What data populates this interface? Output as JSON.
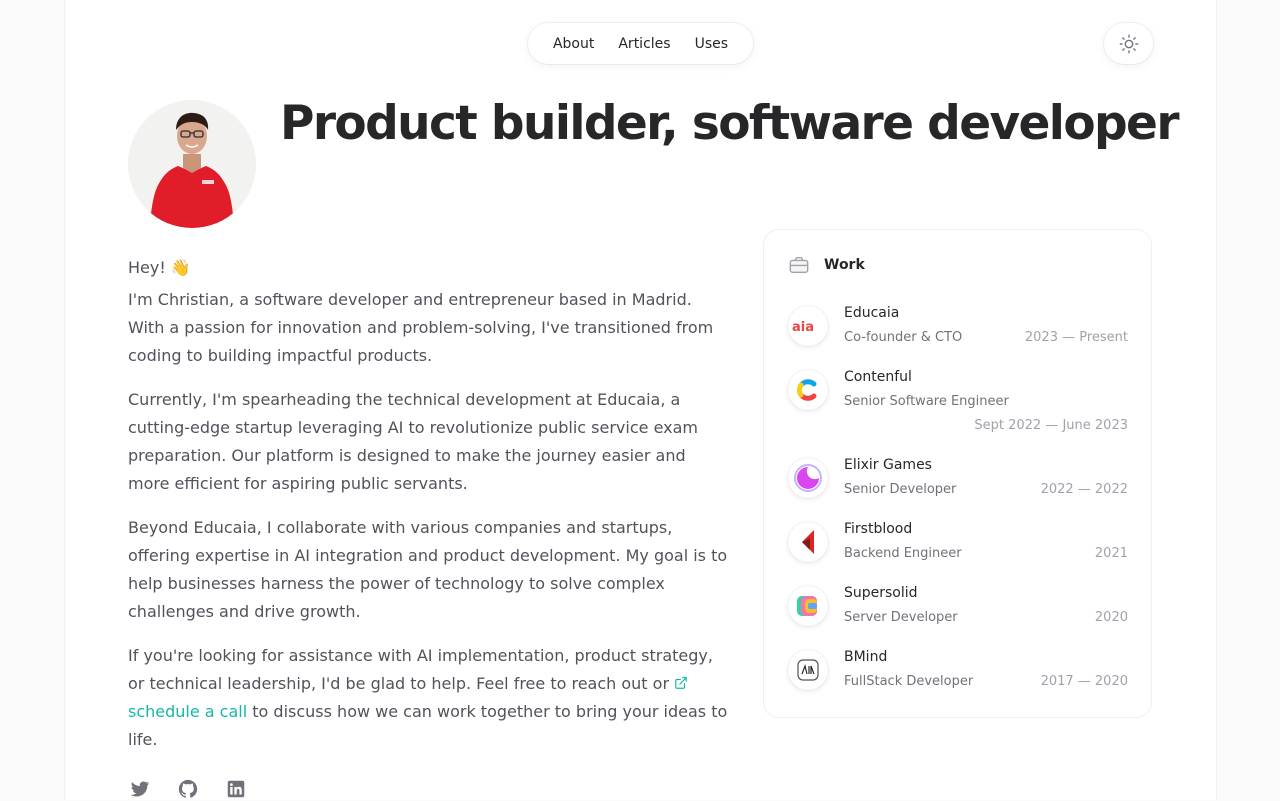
{
  "nav": {
    "items": [
      "About",
      "Articles",
      "Uses"
    ]
  },
  "header": {
    "title": "Product builder, software developer"
  },
  "bio": {
    "greeting": "Hey! 👋",
    "p1": "I'm Christian, a software developer and entrepreneur based in Madrid. With a passion for innovation and problem-solving, I've transitioned from coding to building impactful products.",
    "p2": "Currently, I'm spearheading the technical development at Educaia, a cutting-edge startup leveraging AI to revolutionize public service exam preparation. Our platform is designed to make the journey easier and more efficient for aspiring public servants.",
    "p3": "Beyond Educaia, I collaborate with various companies and startups, offering expertise in AI integration and product development. My goal is to help businesses harness the power of technology to solve complex challenges and drive growth.",
    "p4_before": "If you're looking for assistance with AI implementation, product strategy, or technical leadership, I'd be glad to help. Feel free to reach out or",
    "p4_link": "schedule a call",
    "p4_after": "to discuss how we can work together to bring your ideas to life."
  },
  "socials": [
    "twitter-icon",
    "github-icon",
    "linkedin-icon"
  ],
  "work": {
    "title": "Work",
    "jobs": [
      {
        "company": "Educaia",
        "role": "Co-founder & CTO",
        "dates": "2023 — Present"
      },
      {
        "company": "Contenful",
        "role": "Senior Software Engineer",
        "dates": "Sept 2022 — June 2023"
      },
      {
        "company": "Elixir Games",
        "role": "Senior Developer",
        "dates": "2022 — 2022"
      },
      {
        "company": "Firstblood",
        "role": "Backend Engineer",
        "dates": "2021"
      },
      {
        "company": "Supersolid",
        "role": "Server Developer",
        "dates": "2020"
      },
      {
        "company": "BMind",
        "role": "FullStack Developer",
        "dates": "2017 — 2020"
      }
    ]
  },
  "colors": {
    "accent": "#14b8a6",
    "text": "#27272a",
    "muted": "#52525b"
  }
}
